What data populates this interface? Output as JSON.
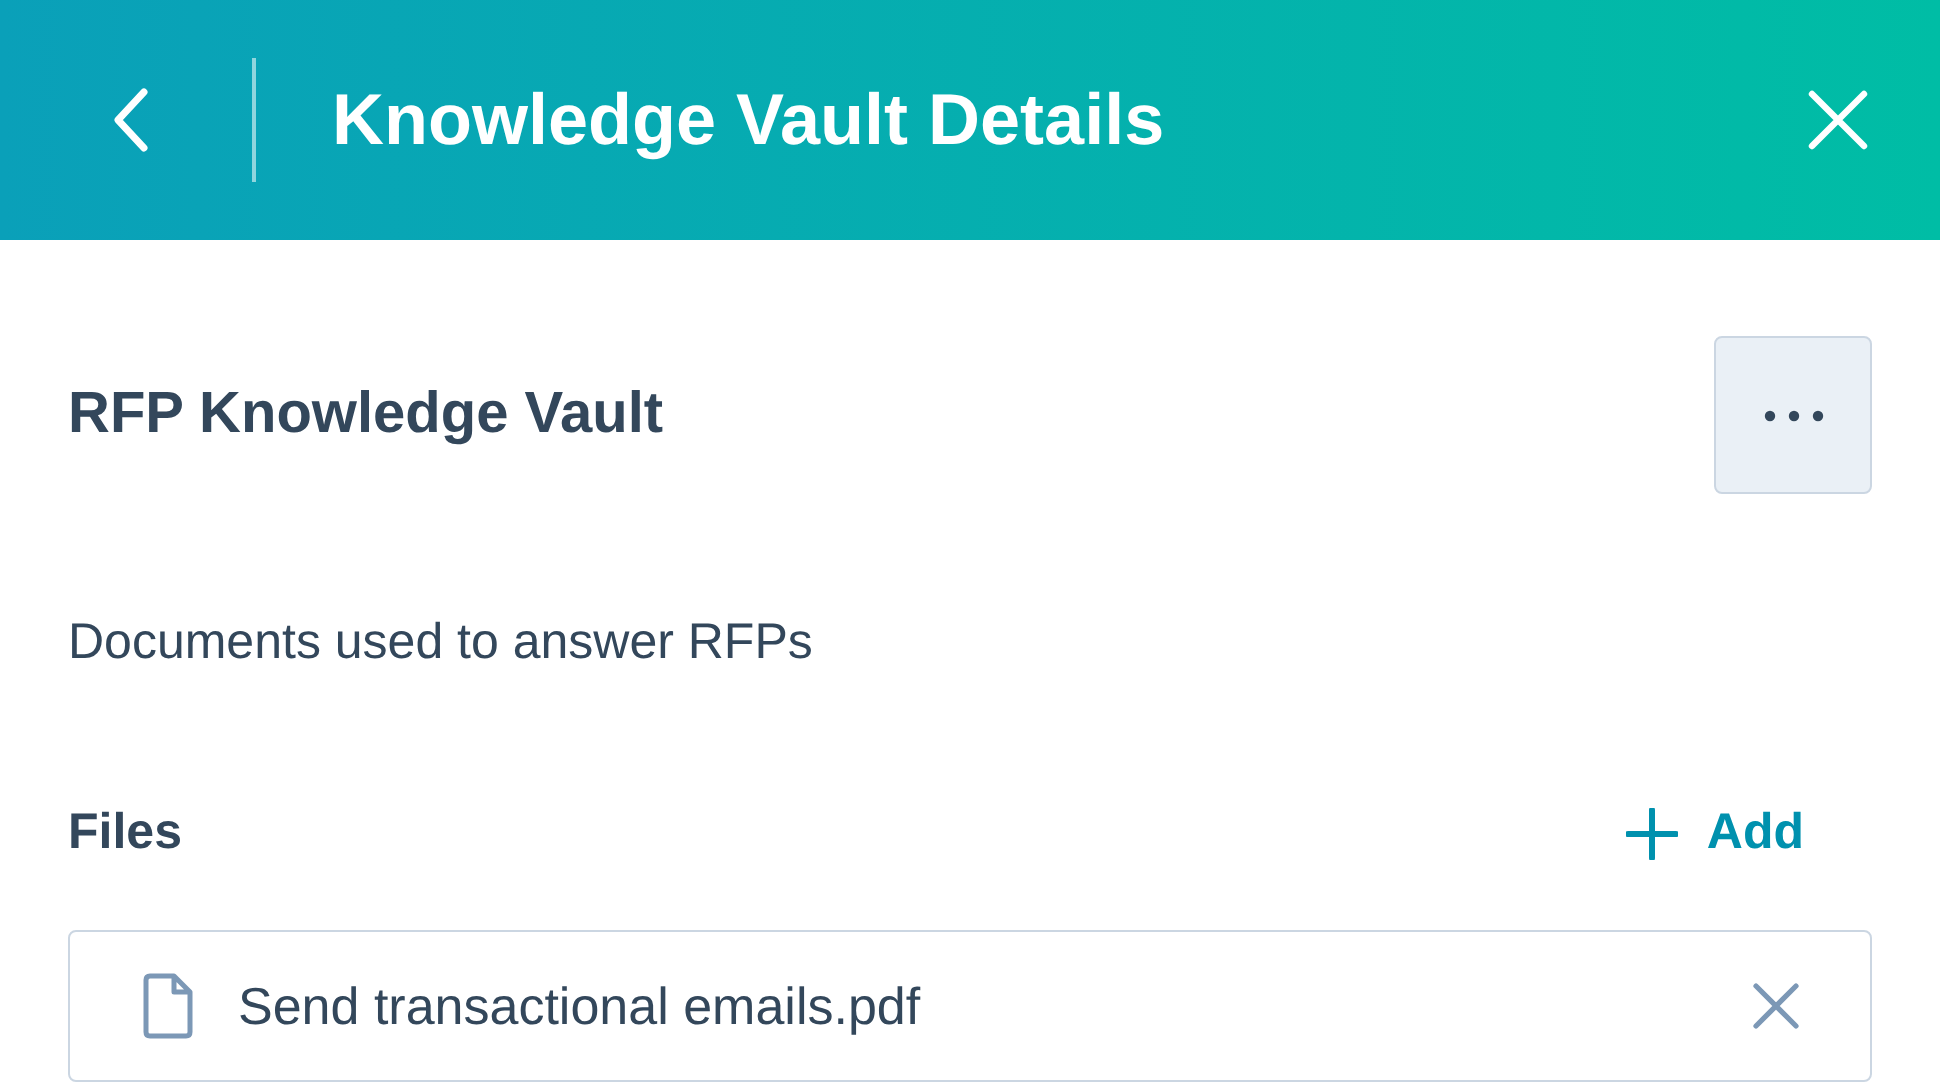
{
  "header": {
    "title": "Knowledge Vault Details"
  },
  "vault": {
    "name": "RFP Knowledge Vault",
    "description": "Documents used to answer RFPs"
  },
  "files": {
    "heading": "Files",
    "add_label": "Add",
    "items": [
      {
        "name": "Send transactional emails.pdf"
      }
    ]
  }
}
